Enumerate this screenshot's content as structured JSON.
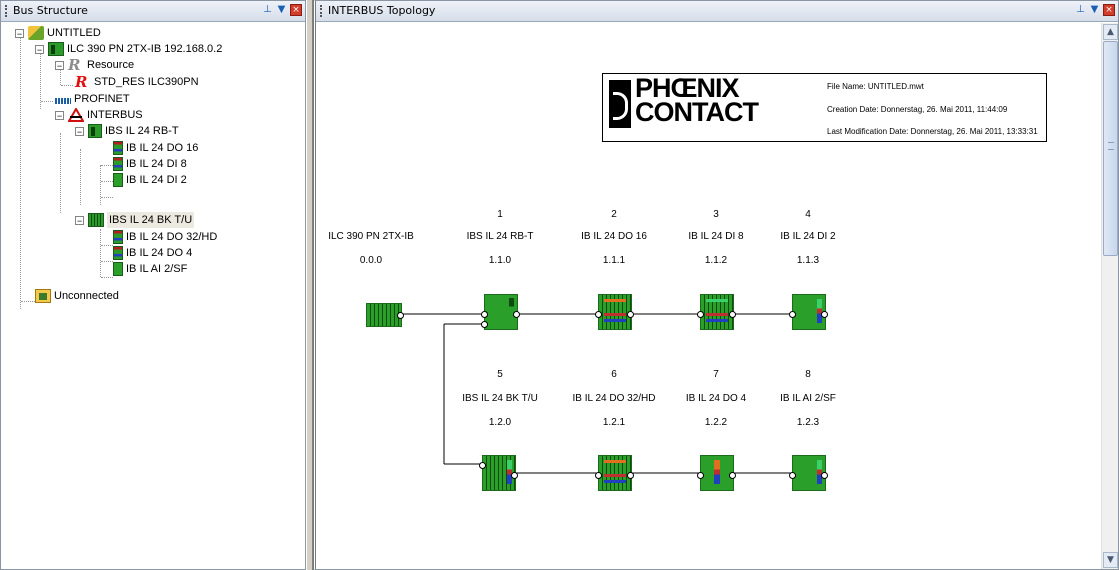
{
  "left_panel": {
    "title": "Bus Structure",
    "tree": {
      "root": "UNTITLED",
      "controller": "ILC 390 PN 2TX-IB 192.168.0.2",
      "resource": "Resource",
      "std_res": "STD_RES ILC390PN",
      "profinet": "PROFINET",
      "interbus": "INTERBUS",
      "rb": "IBS IL 24 RB-T",
      "rb_children": [
        "IB IL 24 DO 16",
        "IB IL 24 DI 8",
        "IB IL 24 DI 2"
      ],
      "bk": "IBS IL 24 BK T/U",
      "bk_children": [
        "IB IL 24 DO 32/HD",
        "IB IL 24 DO 4",
        "IB IL AI 2/SF"
      ],
      "unconnected": "Unconnected"
    }
  },
  "right_panel": {
    "title": "INTERBUS Topology",
    "logo": {
      "line1": "PHŒNIX",
      "line2": "CONTACT",
      "file_name": "File Name: UNTITLED.mwt",
      "creation_date": "Creation Date: Donnerstag, 26. Mai 2011, 11:44:09",
      "last_modification": "Last Modification Date: Donnerstag, 26. Mai 2011, 13:33:31"
    },
    "controller": {
      "name": "ILC 390 PN 2TX-IB",
      "address": "0.0.0"
    },
    "row1": [
      {
        "num": "1",
        "name": "IBS IL 24 RB-T",
        "address": "1.1.0"
      },
      {
        "num": "2",
        "name": "IB IL 24 DO 16",
        "address": "1.1.1"
      },
      {
        "num": "3",
        "name": "IB IL 24 DI 8",
        "address": "1.1.2"
      },
      {
        "num": "4",
        "name": "IB IL 24 DI 2",
        "address": "1.1.3"
      }
    ],
    "row2": [
      {
        "num": "5",
        "name": "IBS IL 24 BK T/U",
        "address": "1.2.0"
      },
      {
        "num": "6",
        "name": "IB IL 24 DO 32/HD",
        "address": "1.2.1"
      },
      {
        "num": "7",
        "name": "IB IL 24 DO 4",
        "address": "1.2.2"
      },
      {
        "num": "8",
        "name": "IB IL AI 2/SF",
        "address": "1.2.3"
      }
    ]
  },
  "icons": {
    "pin": "pin-icon",
    "menu": "dropdown-icon",
    "close": "close-icon"
  }
}
